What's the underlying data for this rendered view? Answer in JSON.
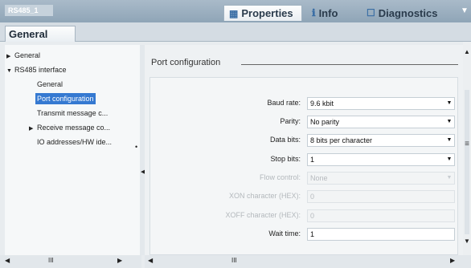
{
  "window": {
    "title": "RS485_1"
  },
  "inspector_tabs": [
    {
      "label": "Properties",
      "icon": "properties-icon"
    },
    {
      "label": "Info",
      "icon": "info-icon"
    },
    {
      "label": "Diagnostics",
      "icon": "diagnostics-icon"
    }
  ],
  "section_tab": "General",
  "nav": {
    "items": [
      {
        "label": "General",
        "expand": "collapsed"
      },
      {
        "label": "RS485 interface",
        "expand": "expanded"
      },
      {
        "label": "General"
      },
      {
        "label": "Port configuration",
        "selected": true
      },
      {
        "label": "Transmit message c..."
      },
      {
        "label": "Receive message co...",
        "expand": "collapsed"
      },
      {
        "label": "IO addresses/HW ide..."
      }
    ]
  },
  "group": {
    "title": "Port configuration"
  },
  "fields": [
    {
      "label": "Baud rate:",
      "value": "9.6 kbit",
      "type": "dropdown",
      "enabled": true
    },
    {
      "label": "Parity:",
      "value": "No parity",
      "type": "dropdown",
      "enabled": true
    },
    {
      "label": "Data bits:",
      "value": "8 bits per character",
      "type": "dropdown",
      "enabled": true
    },
    {
      "label": "Stop bits:",
      "value": "1",
      "type": "dropdown",
      "enabled": true
    },
    {
      "label": "Flow control:",
      "value": "None",
      "type": "dropdown",
      "enabled": false
    },
    {
      "label": "XON character (HEX):",
      "value": "0",
      "type": "text",
      "enabled": false
    },
    {
      "label": "XOFF character (HEX):",
      "value": "0",
      "type": "text",
      "enabled": false
    },
    {
      "label": "Wait time:",
      "value": "1",
      "type": "text",
      "enabled": true
    }
  ],
  "scrollbars": {
    "h_left_mark": "III",
    "h_right_mark": "III"
  },
  "colors": {
    "selection": "#3579d1",
    "header_bar": "#9fb3c4"
  }
}
